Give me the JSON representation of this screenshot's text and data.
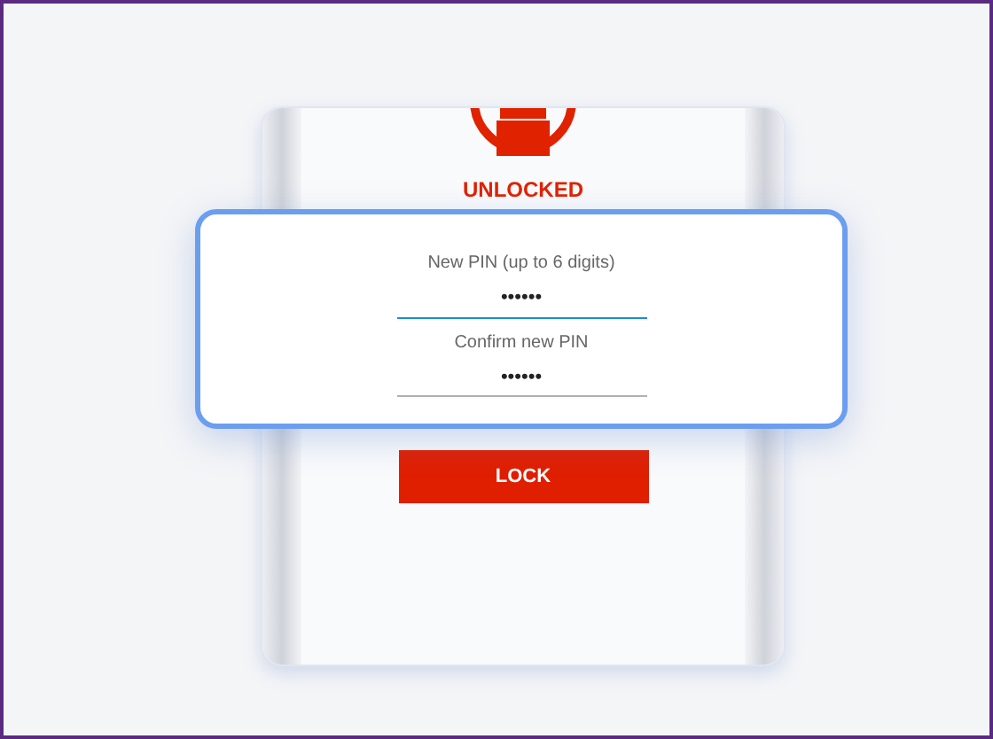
{
  "status": "UNLOCKED",
  "pin_dialog": {
    "fields": [
      {
        "label": "New PIN (up to 6 digits)",
        "value": "••••••",
        "focused": true
      },
      {
        "label": "Confirm new PIN",
        "value": "••••••",
        "focused": false
      }
    ]
  },
  "lock_button": "LOCK"
}
